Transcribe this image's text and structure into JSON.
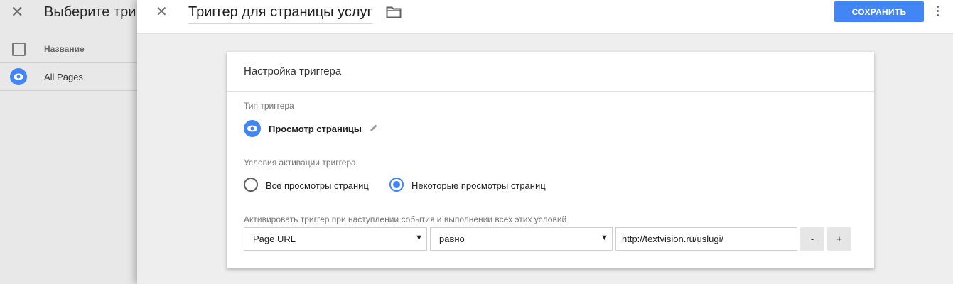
{
  "background_panel": {
    "title": "Выберите три",
    "column_header": "Название",
    "rows": [
      {
        "label": "All Pages",
        "icon": "eye-icon"
      }
    ]
  },
  "drawer": {
    "title": "Триггер для страницы услуг",
    "save_label": "СОХРАНИТЬ",
    "accent_color": "#4285f4"
  },
  "card": {
    "title": "Настройка триггера",
    "trigger_type_label": "Тип триггера",
    "trigger_type_value": "Просмотр страницы",
    "activation_label": "Условия активации триггера",
    "radio_options": [
      {
        "label": "Все просмотры страниц",
        "checked": false
      },
      {
        "label": "Некоторые просмотры страниц",
        "checked": true
      }
    ],
    "condition_label": "Активировать триггер при наступлении события и выполнении всех этих условий",
    "condition": {
      "variable": "Page URL",
      "operator": "равно",
      "value": "http://textvision.ru/uslugi/"
    },
    "remove_label": "-",
    "add_label": "+"
  }
}
